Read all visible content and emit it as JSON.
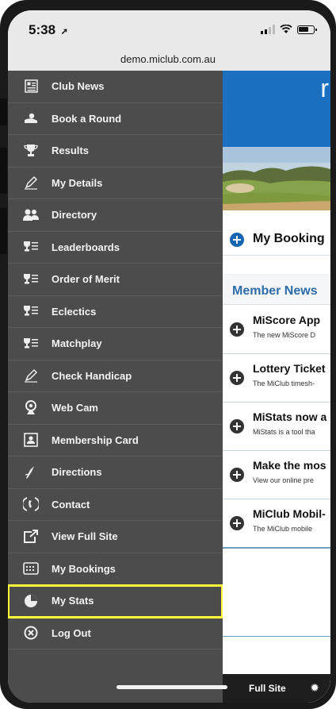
{
  "status_bar": {
    "time": "5:38",
    "url": "demo.miclub.com.au"
  },
  "menu": {
    "items": [
      {
        "label": "Club News",
        "icon": "newspaper-icon"
      },
      {
        "label": "Book a Round",
        "icon": "golf-ball-icon"
      },
      {
        "label": "Results",
        "icon": "trophy-icon"
      },
      {
        "label": "My Details",
        "icon": "pencil-icon"
      },
      {
        "label": "Directory",
        "icon": "people-icon"
      },
      {
        "label": "Leaderboards",
        "icon": "trophy-list-icon"
      },
      {
        "label": "Order of Merit",
        "icon": "trophy-list-icon"
      },
      {
        "label": "Eclectics",
        "icon": "trophy-list-icon"
      },
      {
        "label": "Matchplay",
        "icon": "trophy-list-icon"
      },
      {
        "label": "Check Handicap",
        "icon": "pencil-icon"
      },
      {
        "label": "Web Cam",
        "icon": "webcam-icon"
      },
      {
        "label": "Membership Card",
        "icon": "id-card-icon"
      },
      {
        "label": "Directions",
        "icon": "compass-icon"
      },
      {
        "label": "Contact",
        "icon": "phone-icon"
      },
      {
        "label": "View Full Site",
        "icon": "external-link-icon"
      },
      {
        "label": "My Bookings",
        "icon": "calendar-icon"
      },
      {
        "label": "My Stats",
        "icon": "pie-chart-icon",
        "highlighted": true
      },
      {
        "label": "Log Out",
        "icon": "logout-icon"
      }
    ]
  },
  "content": {
    "banner_letter": "r",
    "bookings_title": "My Booking",
    "member_news_heading": "Member News",
    "news": [
      {
        "title": "MiScore App",
        "sub": "The new MiScore D"
      },
      {
        "title": "Lottery Ticket",
        "sub": "The MiClub timesh-"
      },
      {
        "title": "MiStats now a",
        "sub": "MiStats is a tool tha"
      },
      {
        "title": "Make the mos",
        "sub": "View our online pre"
      },
      {
        "title": "MiClub Mobil-",
        "sub": "The MiClub mobile"
      }
    ],
    "footer_link": "Full Site"
  },
  "colors": {
    "menu_bg": "#4c4c4c",
    "highlight": "#ffff3c",
    "banner_blue": "#1b6fc1",
    "accent_blue": "#1565b0",
    "news_heading": "#2d6ca8"
  }
}
